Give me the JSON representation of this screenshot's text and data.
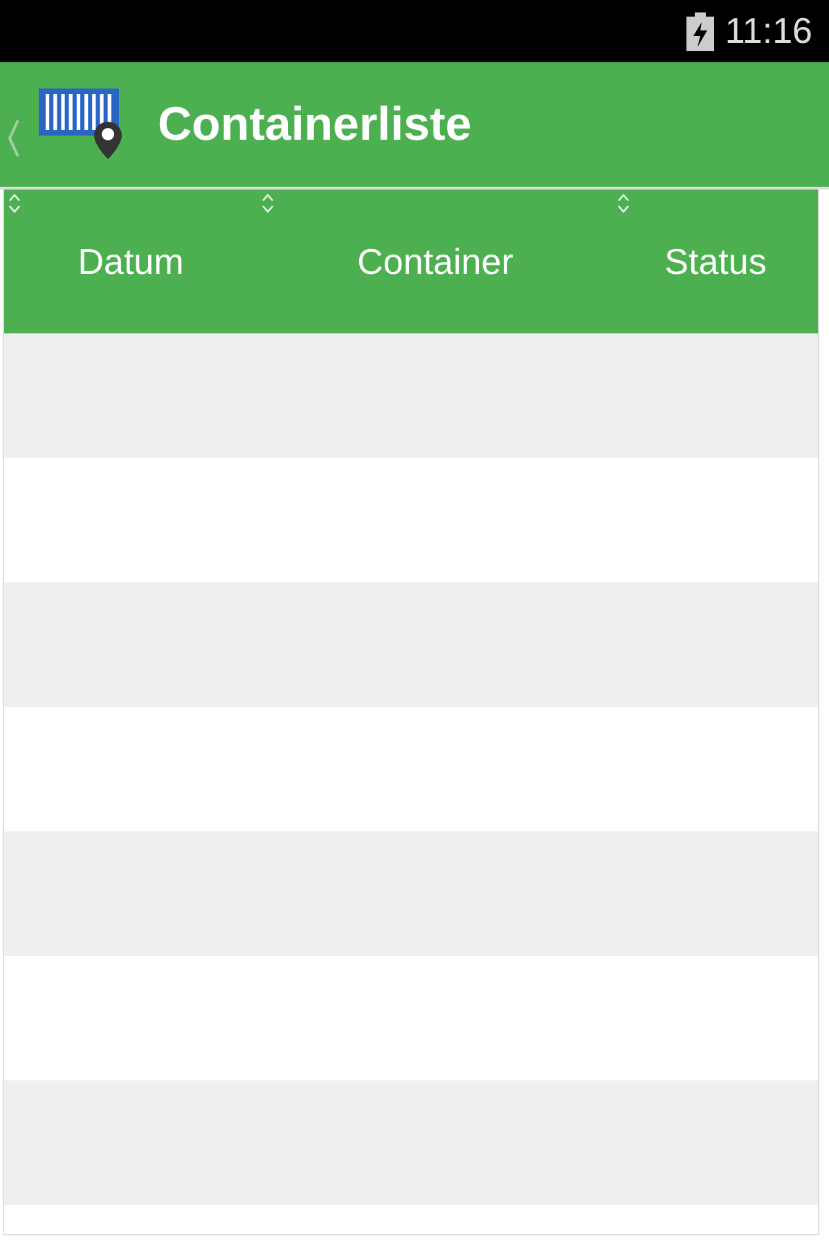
{
  "status_bar": {
    "time": "11:16"
  },
  "app_bar": {
    "title": "Containerliste"
  },
  "table": {
    "columns": [
      {
        "label": "Datum"
      },
      {
        "label": "Container"
      },
      {
        "label": "Status"
      }
    ]
  }
}
